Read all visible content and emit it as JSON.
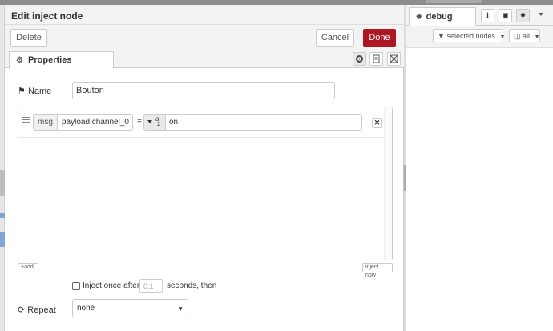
{
  "tray": {
    "title": "Edit inject node",
    "delete_label": "Delete",
    "cancel_label": "Cancel",
    "done_label": "Done",
    "done_color": "#ad1625"
  },
  "tabs": {
    "properties_label": "Properties"
  },
  "form": {
    "name_label": "Name",
    "name_value": "Bouton",
    "props": [
      {
        "prefix": "msg.",
        "property": "payload.channel_0",
        "operator": "=",
        "type": "a-z string",
        "value": "on"
      }
    ],
    "add_label": "add",
    "inject_now_label": "inject now",
    "inject_once_label": "Inject once after",
    "delay_placeholder": "0.1",
    "delay_suffix": "seconds, then",
    "repeat_label": "Repeat",
    "repeat_value": "none"
  },
  "sidebar": {
    "tab_label": "debug",
    "filter_label": "selected nodes",
    "clear_label": "all"
  }
}
